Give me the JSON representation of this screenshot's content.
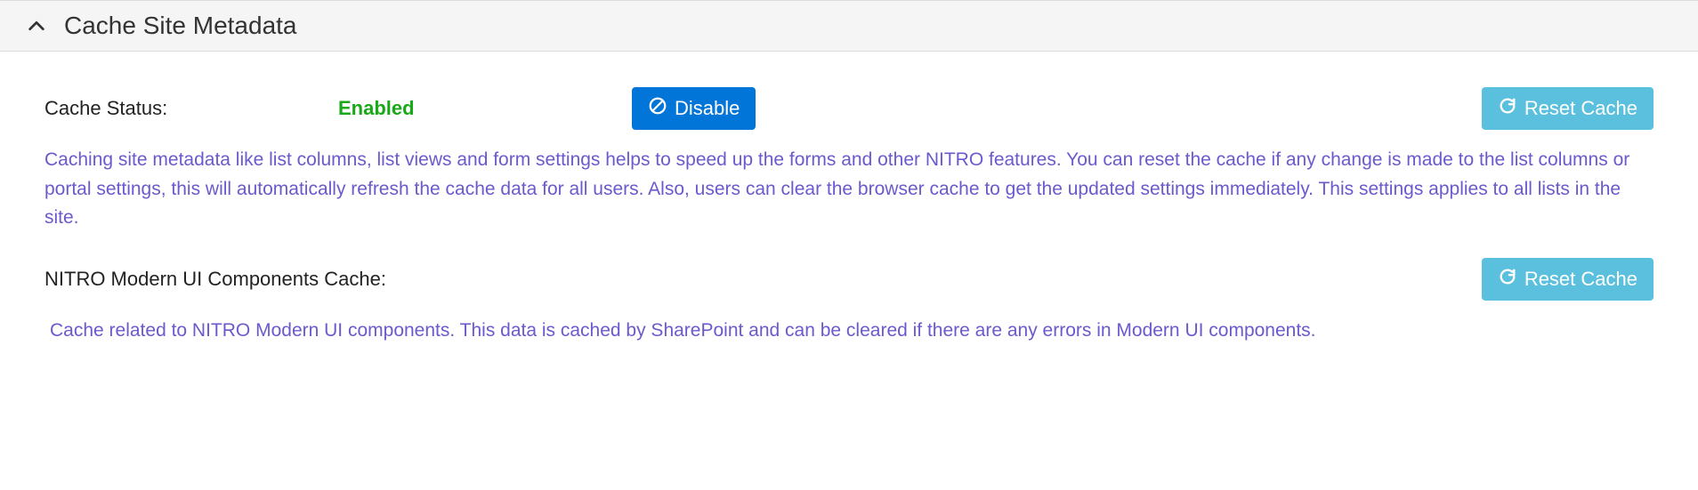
{
  "panel": {
    "title": "Cache Site Metadata"
  },
  "cacheStatus": {
    "label": "Cache Status:",
    "value": "Enabled",
    "disableButton": "Disable",
    "resetButton": "Reset Cache",
    "description": "Caching site metadata like list columns, list views and form settings helps to speed up the forms and other NITRO features. You can reset the cache if any change is made to the list columns or portal settings, this will automatically refresh the cache data for all users. Also, users can clear the browser cache to get the updated settings immediately. This settings applies to all lists in the site."
  },
  "modernUI": {
    "label": "NITRO Modern UI Components Cache:",
    "resetButton": "Reset Cache",
    "description": "Cache related to NITRO Modern UI components. This data is cached by SharePoint and can be cleared if there are any errors in Modern UI components."
  }
}
